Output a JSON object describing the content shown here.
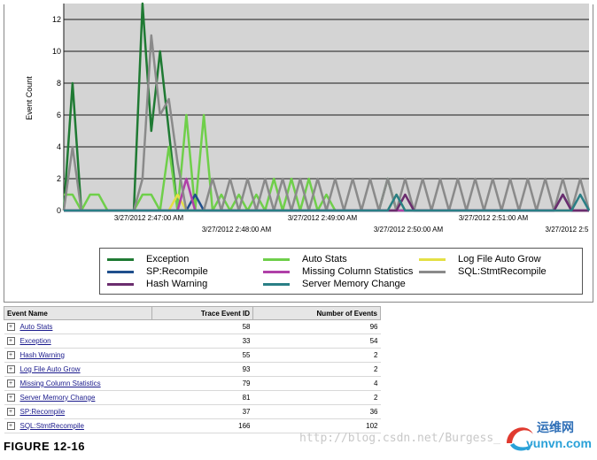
{
  "chart_data": {
    "type": "line",
    "ylabel": "Event Count",
    "xlabel": "",
    "ylim": [
      0,
      13
    ],
    "yticks": [
      0,
      2,
      4,
      6,
      8,
      10,
      12
    ],
    "grid": true,
    "legend_position": "bottom",
    "x_tick_labels_upper": [
      "3/27/2012 2:47:00 AM",
      "3/27/2012 2:49:00 AM",
      "3/27/2012 2:51:00 AM"
    ],
    "x_tick_labels_lower": [
      "3/27/2012 2:48:00 AM",
      "3/27/2012 2:50:00 AM",
      "3/27/2012 2:5"
    ],
    "series": [
      {
        "name": "Exception",
        "color": "#1f7a33",
        "points": [
          [
            0,
            0
          ],
          [
            1,
            8
          ],
          [
            2,
            0
          ],
          [
            3,
            0
          ],
          [
            4,
            0
          ],
          [
            5,
            0
          ],
          [
            6,
            0
          ],
          [
            7,
            0
          ],
          [
            8,
            0
          ],
          [
            9,
            13
          ],
          [
            10,
            5
          ],
          [
            11,
            10
          ],
          [
            12,
            5
          ],
          [
            13,
            0
          ],
          [
            14,
            0
          ],
          [
            15,
            0
          ],
          [
            36,
            0
          ],
          [
            37,
            2
          ],
          [
            38,
            0
          ],
          [
            39,
            0
          ],
          [
            60,
            0
          ]
        ]
      },
      {
        "name": "Auto Stats",
        "color": "#6fcf4a",
        "points": [
          [
            0,
            1
          ],
          [
            1,
            1
          ],
          [
            2,
            0
          ],
          [
            3,
            1
          ],
          [
            4,
            1
          ],
          [
            5,
            0
          ],
          [
            6,
            0
          ],
          [
            7,
            0
          ],
          [
            8,
            0
          ],
          [
            9,
            1
          ],
          [
            10,
            1
          ],
          [
            11,
            0
          ],
          [
            12,
            4
          ],
          [
            13,
            0
          ],
          [
            14,
            6
          ],
          [
            15,
            0
          ],
          [
            16,
            6
          ],
          [
            17,
            0
          ],
          [
            18,
            1
          ],
          [
            19,
            0
          ],
          [
            20,
            1
          ],
          [
            21,
            0
          ],
          [
            22,
            1
          ],
          [
            23,
            0
          ],
          [
            24,
            2
          ],
          [
            25,
            0
          ],
          [
            26,
            2
          ],
          [
            27,
            0
          ],
          [
            28,
            2
          ],
          [
            29,
            0
          ],
          [
            30,
            1
          ],
          [
            31,
            0
          ],
          [
            60,
            0
          ]
        ]
      },
      {
        "name": "Log File Auto Grow",
        "color": "#e4e045",
        "points": [
          [
            0,
            0
          ],
          [
            12,
            0
          ],
          [
            13,
            1
          ],
          [
            14,
            0
          ],
          [
            37,
            0
          ],
          [
            38,
            1
          ],
          [
            39,
            0
          ],
          [
            40,
            0
          ],
          [
            60,
            0
          ]
        ]
      },
      {
        "name": "SP:Recompile",
        "color": "#1f4f8c",
        "points": [
          [
            0,
            0
          ],
          [
            14,
            0
          ],
          [
            15,
            1
          ],
          [
            16,
            0
          ],
          [
            56,
            0
          ],
          [
            57,
            1
          ],
          [
            58,
            0
          ],
          [
            60,
            0
          ]
        ]
      },
      {
        "name": "Missing Column Statistics",
        "color": "#b040a8",
        "points": [
          [
            0,
            0
          ],
          [
            13,
            0
          ],
          [
            14,
            2
          ],
          [
            15,
            0
          ],
          [
            60,
            0
          ]
        ]
      },
      {
        "name": "SQL:StmtRecompile",
        "color": "#8a8a8a",
        "points": [
          [
            0,
            0
          ],
          [
            1,
            4
          ],
          [
            2,
            0
          ],
          [
            3,
            0
          ],
          [
            4,
            0
          ],
          [
            5,
            0
          ],
          [
            6,
            0
          ],
          [
            7,
            0
          ],
          [
            8,
            0
          ],
          [
            9,
            2
          ],
          [
            10,
            11
          ],
          [
            11,
            6
          ],
          [
            12,
            7
          ],
          [
            13,
            3
          ],
          [
            14,
            0
          ],
          [
            15,
            0
          ],
          [
            16,
            0
          ],
          [
            17,
            2
          ],
          [
            18,
            0
          ],
          [
            19,
            2
          ],
          [
            20,
            0
          ],
          [
            21,
            2
          ],
          [
            22,
            0
          ],
          [
            23,
            2
          ],
          [
            24,
            0
          ],
          [
            25,
            2
          ],
          [
            26,
            0
          ],
          [
            27,
            2
          ],
          [
            28,
            0
          ],
          [
            29,
            2
          ],
          [
            30,
            0
          ],
          [
            31,
            2
          ],
          [
            32,
            0
          ],
          [
            33,
            2
          ],
          [
            34,
            0
          ],
          [
            35,
            2
          ],
          [
            36,
            0
          ],
          [
            37,
            2
          ],
          [
            38,
            0
          ],
          [
            39,
            2
          ],
          [
            40,
            0
          ],
          [
            41,
            2
          ],
          [
            42,
            0
          ],
          [
            43,
            2
          ],
          [
            44,
            0
          ],
          [
            45,
            2
          ],
          [
            46,
            0
          ],
          [
            47,
            2
          ],
          [
            48,
            0
          ],
          [
            49,
            2
          ],
          [
            50,
            0
          ],
          [
            51,
            2
          ],
          [
            52,
            0
          ],
          [
            53,
            2
          ],
          [
            54,
            0
          ],
          [
            55,
            2
          ],
          [
            56,
            0
          ],
          [
            57,
            2
          ],
          [
            58,
            0
          ],
          [
            59,
            2
          ],
          [
            60,
            0
          ]
        ]
      },
      {
        "name": "Hash Warning",
        "color": "#6b2d6e",
        "points": [
          [
            0,
            0
          ],
          [
            38,
            0
          ],
          [
            39,
            1
          ],
          [
            40,
            0
          ],
          [
            56,
            0
          ],
          [
            57,
            1
          ],
          [
            58,
            0
          ],
          [
            60,
            0
          ]
        ]
      },
      {
        "name": "Server Memory Change",
        "color": "#2a7f86",
        "points": [
          [
            0,
            0
          ],
          [
            37,
            0
          ],
          [
            38,
            1
          ],
          [
            39,
            0
          ],
          [
            58,
            0
          ],
          [
            59,
            1
          ],
          [
            60,
            0
          ]
        ]
      }
    ]
  },
  "legend": {
    "items": [
      {
        "label": "Exception",
        "color": "#1f7a33"
      },
      {
        "label": "Auto Stats",
        "color": "#6fcf4a"
      },
      {
        "label": "Log File Auto Grow",
        "color": "#e4e045"
      },
      {
        "label": "SP:Recompile",
        "color": "#1f4f8c"
      },
      {
        "label": "Missing Column Statistics",
        "color": "#b040a8"
      },
      {
        "label": "SQL:StmtRecompile",
        "color": "#8a8a8a"
      },
      {
        "label": "Hash Warning",
        "color": "#6b2d6e"
      },
      {
        "label": "Server Memory Change",
        "color": "#2a7f86"
      }
    ]
  },
  "table": {
    "headers": [
      "Event Name",
      "Trace Event ID",
      "Number of Events"
    ],
    "rows": [
      {
        "name": "Auto Stats",
        "id": "58",
        "count": "96"
      },
      {
        "name": "Exception",
        "id": "33",
        "count": "54"
      },
      {
        "name": "Hash Warning",
        "id": "55",
        "count": "2"
      },
      {
        "name": "Log File Auto Grow",
        "id": "93",
        "count": "2"
      },
      {
        "name": "Missing Column Statistics",
        "id": "79",
        "count": "4"
      },
      {
        "name": "Server Memory Change",
        "id": "81",
        "count": "2"
      },
      {
        "name": "SP:Recompile",
        "id": "37",
        "count": "36"
      },
      {
        "name": "SQL:StmtRecompile",
        "id": "166",
        "count": "102"
      }
    ],
    "expander_symbol": "+"
  },
  "caption": "FIGURE 12-16",
  "watermark": "http://blog.csdn.net/Burgess_",
  "logo": {
    "cn": "运维网",
    "en": "yunvn.com"
  }
}
